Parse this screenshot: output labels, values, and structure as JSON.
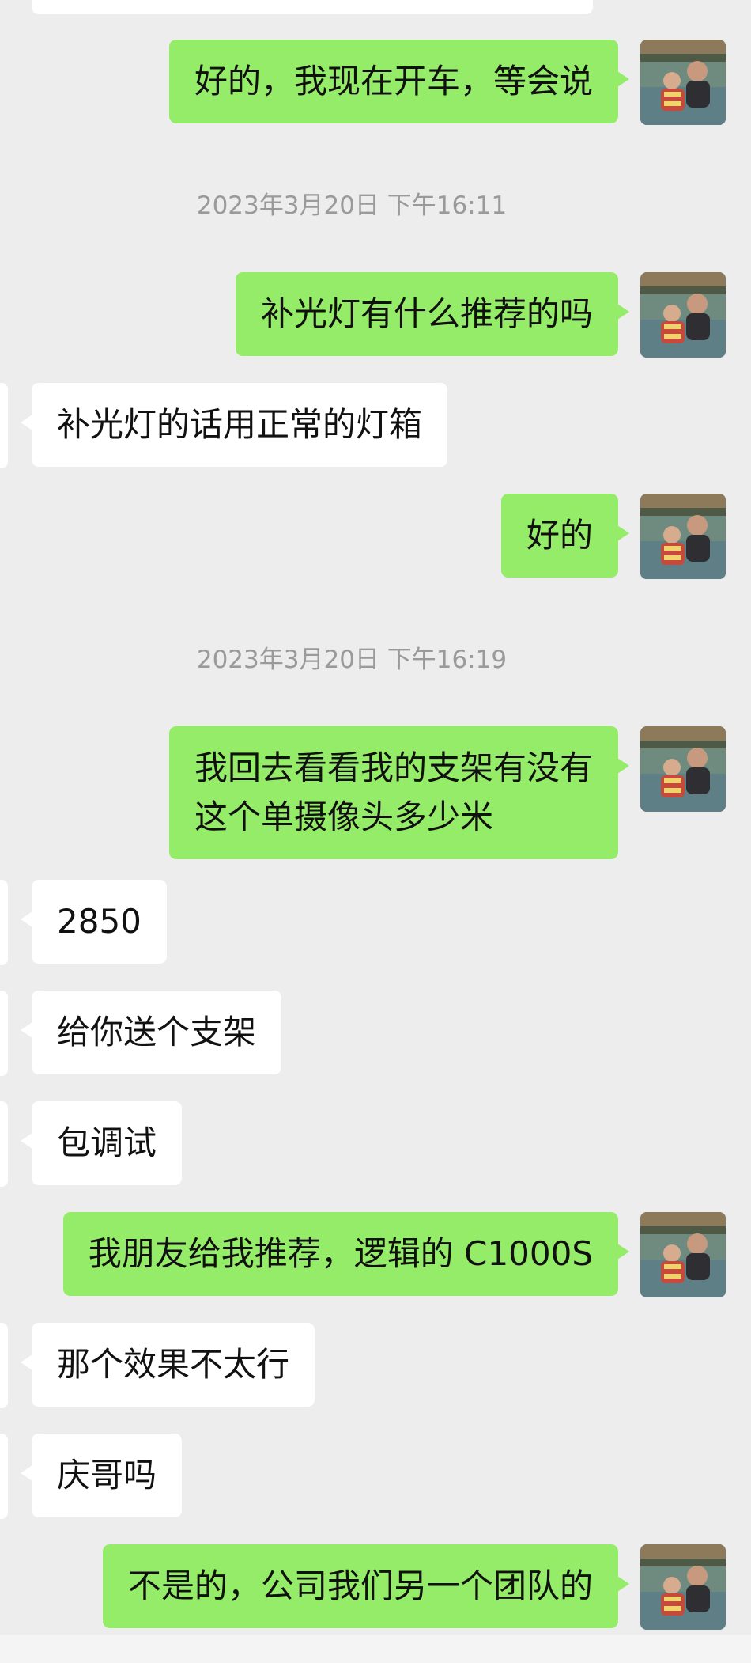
{
  "messages": [
    {
      "side": "me",
      "lines": [
        "好的，我现在开车，等会说"
      ]
    },
    {
      "time": "2023年3月20日 下午16:11"
    },
    {
      "side": "me",
      "lines": [
        "补光灯有什么推荐的吗"
      ]
    },
    {
      "side": "them",
      "lines": [
        "补光灯的话用正常的灯箱"
      ]
    },
    {
      "side": "me",
      "lines": [
        "好的"
      ]
    },
    {
      "time": "2023年3月20日 下午16:19"
    },
    {
      "side": "me",
      "lines": [
        "我回去看看我的支架有没有",
        "这个单摄像头多少米"
      ]
    },
    {
      "side": "them",
      "lines": [
        "2850"
      ]
    },
    {
      "side": "them",
      "lines": [
        "给你送个支架"
      ]
    },
    {
      "side": "them",
      "lines": [
        "包调试"
      ]
    },
    {
      "side": "me",
      "lines": [
        "我朋友给我推荐，逻辑的 C1000S"
      ]
    },
    {
      "side": "them",
      "lines": [
        "那个效果不太行"
      ]
    },
    {
      "side": "them",
      "lines": [
        "庆哥吗"
      ]
    },
    {
      "side": "me",
      "lines": [
        "不是的，公司我们另一个团队的"
      ]
    }
  ],
  "colors": {
    "sent_bubble": "#95ec69",
    "received_bubble": "#ffffff",
    "background": "#ededed",
    "timestamp": "#9a9a9a"
  },
  "avatar_icon": "user-photo-avatar"
}
